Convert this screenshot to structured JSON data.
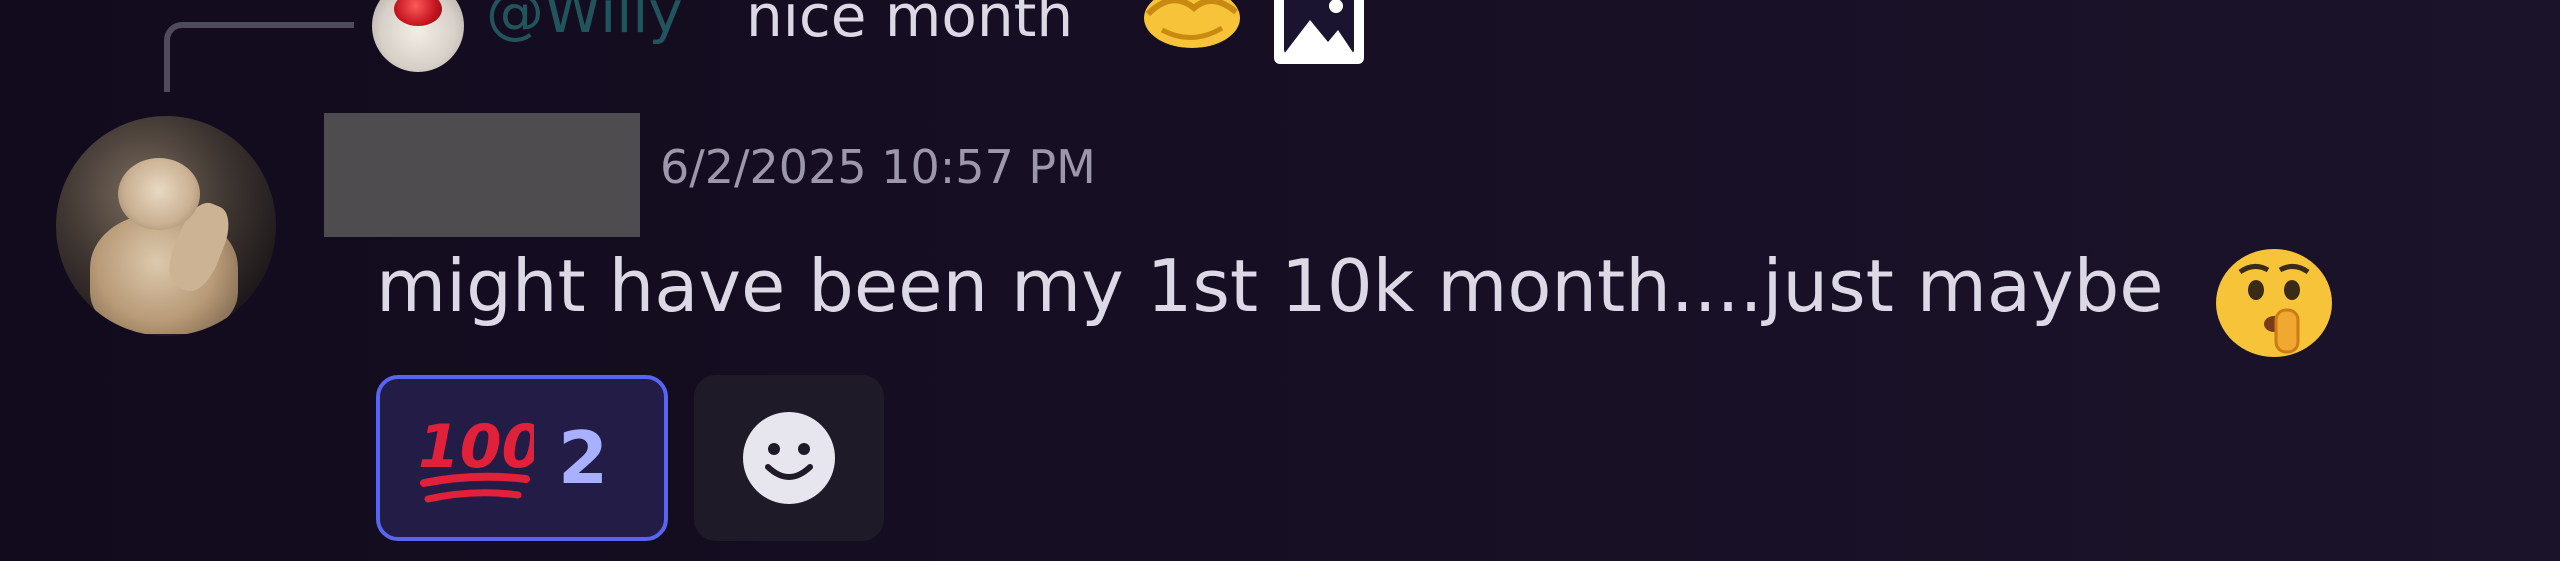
{
  "reply": {
    "mention": "@Willy",
    "text": "nice month",
    "emoji_icon": "handshake-emoji",
    "attachment_icon": "image-icon"
  },
  "message": {
    "timestamp": "6/2/2025 10:57 PM",
    "text": "might have been my 1st 10k month....just maybe",
    "emoji_icon": "shushing-face-emoji"
  },
  "reactions": [
    {
      "emoji_icon": "hundred-points-emoji",
      "count": "2",
      "selected": true
    }
  ],
  "add_reaction_icon": "smiley-face-icon",
  "colors": {
    "background": "#150e21",
    "reaction_border": "#5865f2",
    "reaction_bg": "#221c46",
    "reaction_count": "#a8b1ff",
    "mention": "#2f8f8f",
    "timestamp": "#9c97ab",
    "message_text": "#dcd8e5"
  }
}
